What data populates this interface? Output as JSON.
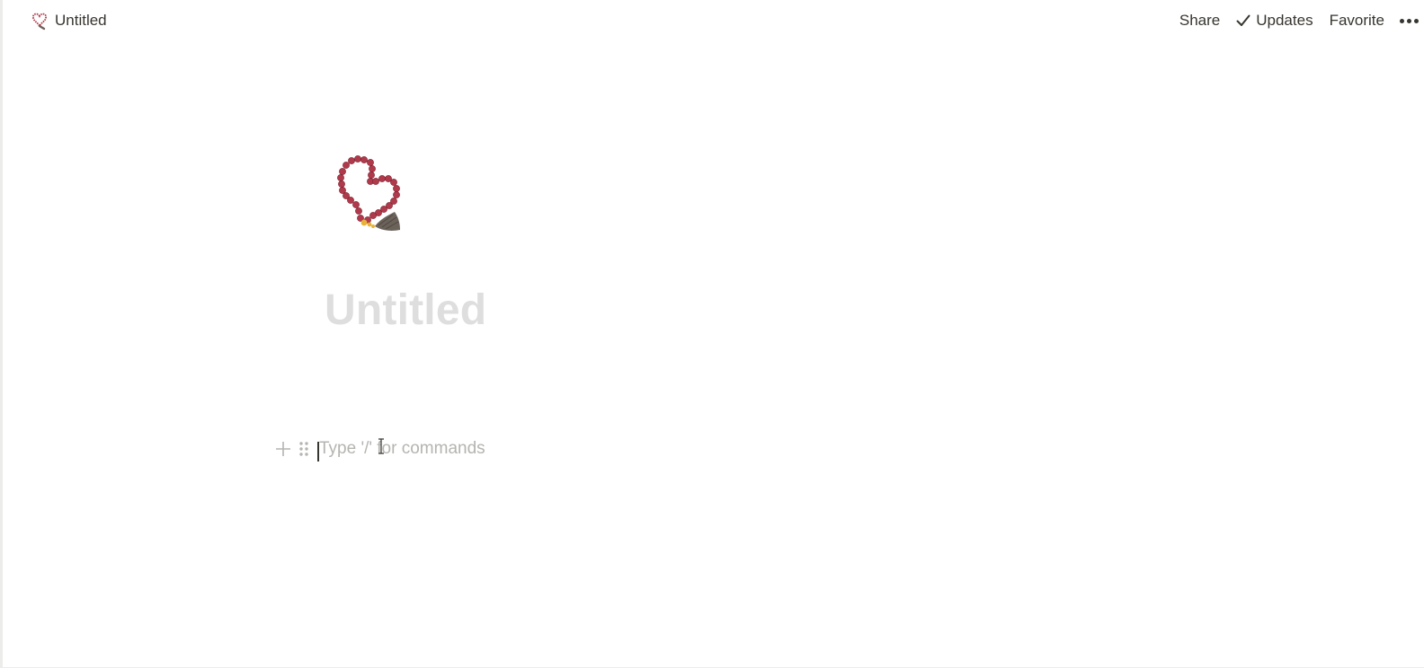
{
  "topbar": {
    "breadcrumb_title": "Untitled",
    "breadcrumb_icon": "prayer-beads-icon",
    "actions": {
      "share": "Share",
      "updates": "Updates",
      "favorite": "Favorite",
      "more_icon": "more-horizontal-icon"
    }
  },
  "page": {
    "icon": "prayer-beads-emoji",
    "title_placeholder": "Untitled",
    "block_placeholder": "Type '/' for commands"
  },
  "colors": {
    "text": "#37352f",
    "placeholder": "#b4b4b0",
    "title_placeholder": "#dedede",
    "bead_red": "#b03a4b",
    "tassel": "#6b625a",
    "accent_gold": "#e8b23a"
  }
}
